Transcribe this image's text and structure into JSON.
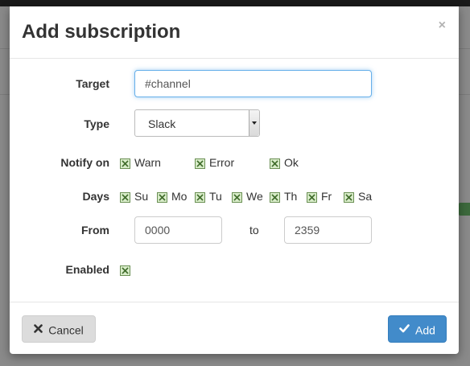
{
  "modal": {
    "title": "Add subscription",
    "close_label": "×"
  },
  "form": {
    "target": {
      "label": "Target",
      "value": "#channel"
    },
    "type": {
      "label": "Type",
      "selected": "Slack"
    },
    "notify_on": {
      "label": "Notify on",
      "options": [
        {
          "label": "Warn",
          "checked": true
        },
        {
          "label": "Error",
          "checked": true
        },
        {
          "label": "Ok",
          "checked": true
        }
      ]
    },
    "days": {
      "label": "Days",
      "options": [
        {
          "label": "Su",
          "checked": true
        },
        {
          "label": "Mo",
          "checked": true
        },
        {
          "label": "Tu",
          "checked": true
        },
        {
          "label": "We",
          "checked": true
        },
        {
          "label": "Th",
          "checked": true
        },
        {
          "label": "Fr",
          "checked": true
        },
        {
          "label": "Sa",
          "checked": true
        }
      ]
    },
    "from": {
      "label": "From",
      "start": "0000",
      "separator": "to",
      "end": "2359"
    },
    "enabled": {
      "label": "Enabled",
      "checked": true
    }
  },
  "footer": {
    "cancel_label": "Cancel",
    "cancel_icon": "times-icon",
    "add_label": "Add",
    "add_icon": "check-icon"
  },
  "colors": {
    "primary": "#428bca",
    "checkbox_fill": "#d8ecc9",
    "checkbox_border": "#6a8f53",
    "focus_ring": "#66afe9"
  }
}
